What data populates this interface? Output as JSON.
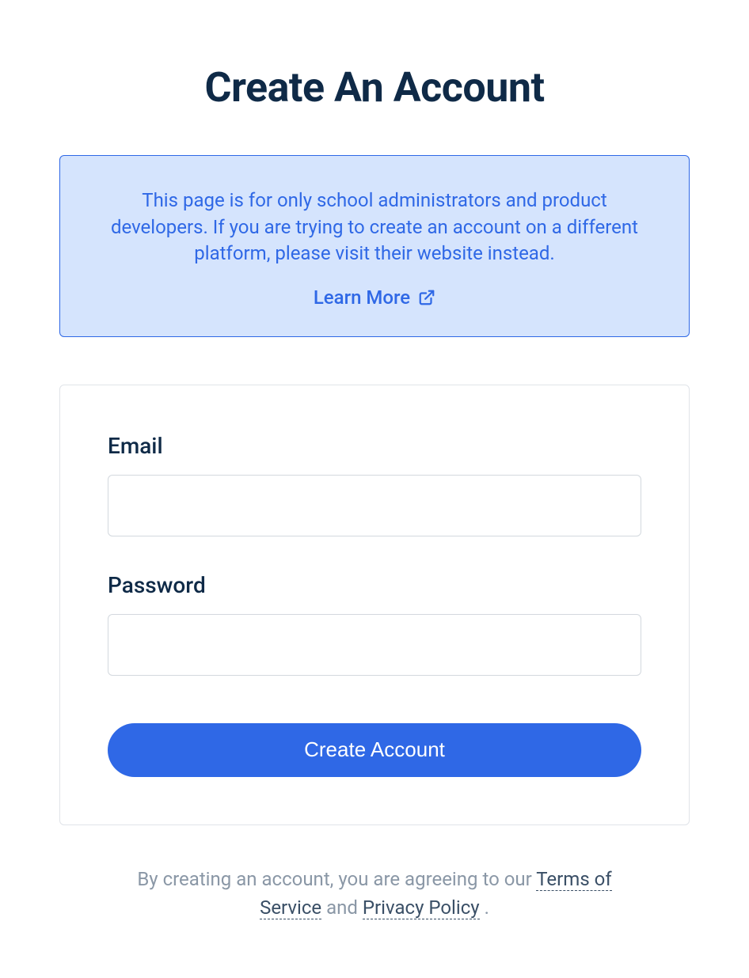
{
  "page": {
    "title": "Create An Account"
  },
  "banner": {
    "text": "This page is for only school administrators and product developers. If you are trying to create an account on a different platform, please visit their website instead.",
    "learn_more_label": "Learn More"
  },
  "form": {
    "email": {
      "label": "Email",
      "value": ""
    },
    "password": {
      "label": "Password",
      "value": ""
    },
    "submit_label": "Create Account"
  },
  "footer": {
    "prefix": "By creating an account, you are agreeing to our ",
    "tos_label": "Terms of Service",
    "connector": " and ",
    "privacy_label": "Privacy Policy",
    "suffix": "."
  }
}
